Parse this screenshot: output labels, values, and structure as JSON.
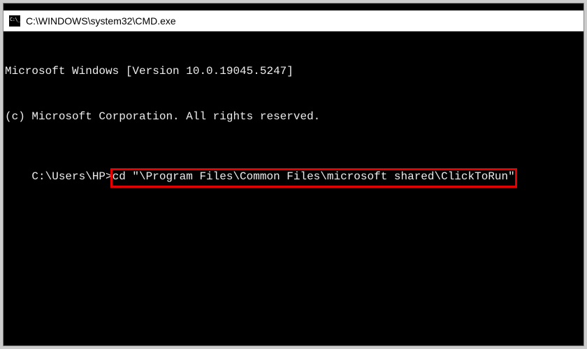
{
  "window": {
    "title": "C:\\WINDOWS\\system32\\CMD.exe"
  },
  "terminal": {
    "line1": "Microsoft Windows [Version 10.0.19045.5247]",
    "line2": "(c) Microsoft Corporation. All rights reserved.",
    "blank": "",
    "prompt": "C:\\Users\\HP>",
    "command": "cd \"\\Program Files\\Common Files\\microsoft shared\\ClickToRun\""
  },
  "highlight": {
    "color": "#e80000"
  }
}
